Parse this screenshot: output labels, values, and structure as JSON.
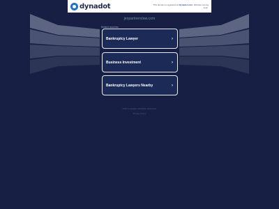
{
  "header": {
    "logo_text": "dynadot",
    "notice_prefix": "This domain is registered at",
    "notice_brand": "Dynadot.com",
    "notice_suffix": ". Website coming soon."
  },
  "domain": "jexpartnerslaw.com",
  "related_label": "Related searches",
  "results": [
    {
      "label": "Bankruptcy Lawyer"
    },
    {
      "label": "Business Investment"
    },
    {
      "label": "Bankruptcy Lawyers Nearby"
    }
  ],
  "footer": {
    "copyright": "2025 Copyright. All Rights Reserved.",
    "privacy": "Privacy Policy"
  },
  "colors": {
    "background": "#172044",
    "card": "#1c2a58",
    "card_border": "#e8ecf5",
    "brand": "#1d73c9"
  }
}
